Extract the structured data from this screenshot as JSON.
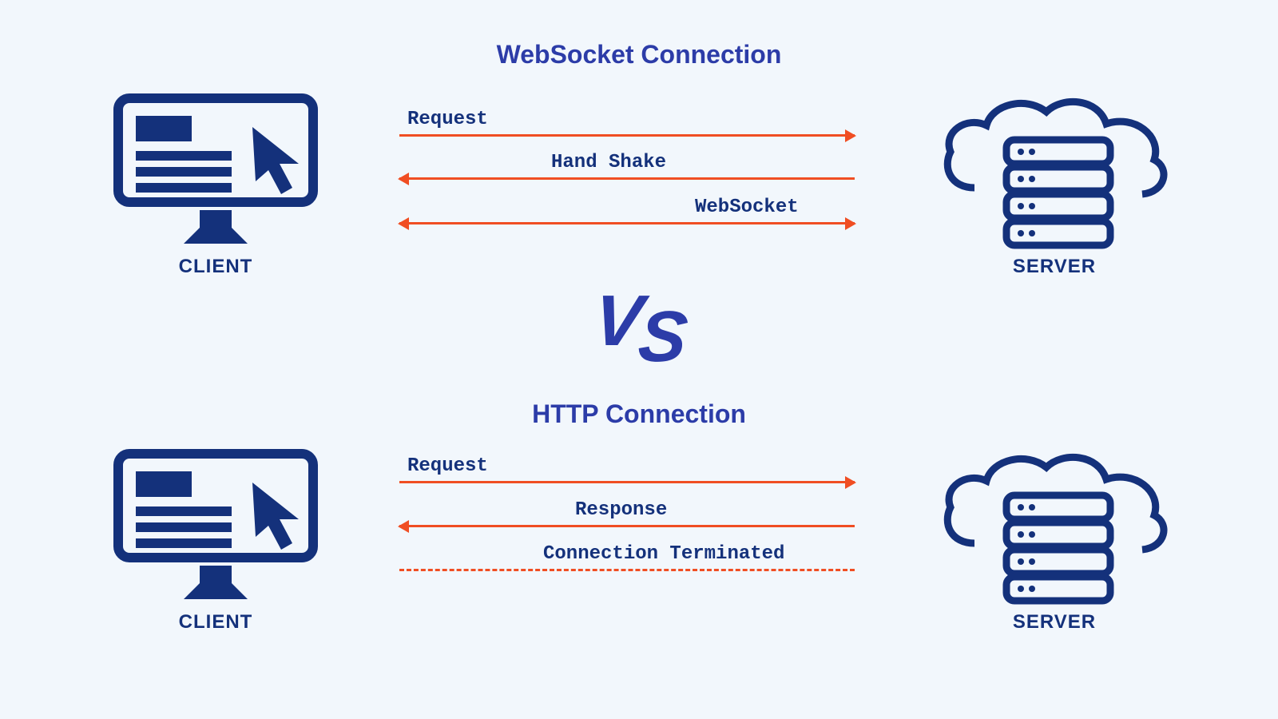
{
  "colors": {
    "navy": "#14317b",
    "blue": "#2c3ca8",
    "orange": "#f04e23",
    "bg": "#f2f7fc"
  },
  "titles": {
    "top": "WebSocket Connection",
    "bottom": "HTTP Connection"
  },
  "vs": "VS",
  "nodes": {
    "client": "CLIENT",
    "server": "SERVER"
  },
  "websocket_arrows": {
    "a1": {
      "label": "Request",
      "dir": "right"
    },
    "a2": {
      "label": "Hand Shake",
      "dir": "left"
    },
    "a3": {
      "label": "WebSocket",
      "dir": "both"
    }
  },
  "http_arrows": {
    "a1": {
      "label": "Request",
      "dir": "right"
    },
    "a2": {
      "label": "Response",
      "dir": "left"
    },
    "a3": {
      "label": "Connection Terminated",
      "dir": "none_dashed"
    }
  }
}
